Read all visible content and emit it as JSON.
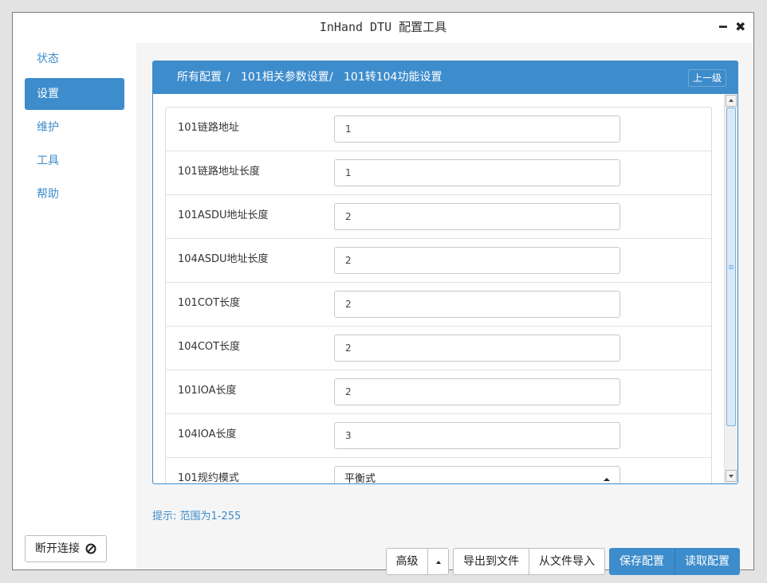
{
  "window": {
    "title": "InHand DTU 配置工具",
    "minimize": "━",
    "close": "✖"
  },
  "sidebar": {
    "items": [
      {
        "label": "状态",
        "active": false
      },
      {
        "label": "设置",
        "active": true
      },
      {
        "label": "维护",
        "active": false
      },
      {
        "label": "工具",
        "active": false
      },
      {
        "label": "帮助",
        "active": false
      }
    ],
    "disconnect_label": "断开连接",
    "disconnect_icon": "ban-icon"
  },
  "breadcrumb": {
    "items": [
      "所有配置",
      "101相关参数设置",
      "101转104功能设置"
    ],
    "separator": "/",
    "up_label": "上一级"
  },
  "form": {
    "rows": [
      {
        "label": "101链路地址",
        "value": "1"
      },
      {
        "label": "101链路地址长度",
        "value": "1"
      },
      {
        "label": "101ASDU地址长度",
        "value": "2"
      },
      {
        "label": "104ASDU地址长度",
        "value": "2"
      },
      {
        "label": "101COT长度",
        "value": "2"
      },
      {
        "label": "104COT长度",
        "value": "2"
      },
      {
        "label": "101IOA长度",
        "value": "2"
      },
      {
        "label": "104IOA长度",
        "value": "3"
      }
    ],
    "select_row": {
      "label": "101规约模式",
      "value": "平衡式"
    }
  },
  "hint": "提示: 范围为1-255",
  "footer": {
    "advanced_label": "高级",
    "export_label": "导出到文件",
    "import_label": "从文件导入",
    "save_label": "保存配置",
    "read_label": "读取配置"
  },
  "colors": {
    "accent": "#3d8ccc",
    "hint": "#3d8ccc"
  }
}
